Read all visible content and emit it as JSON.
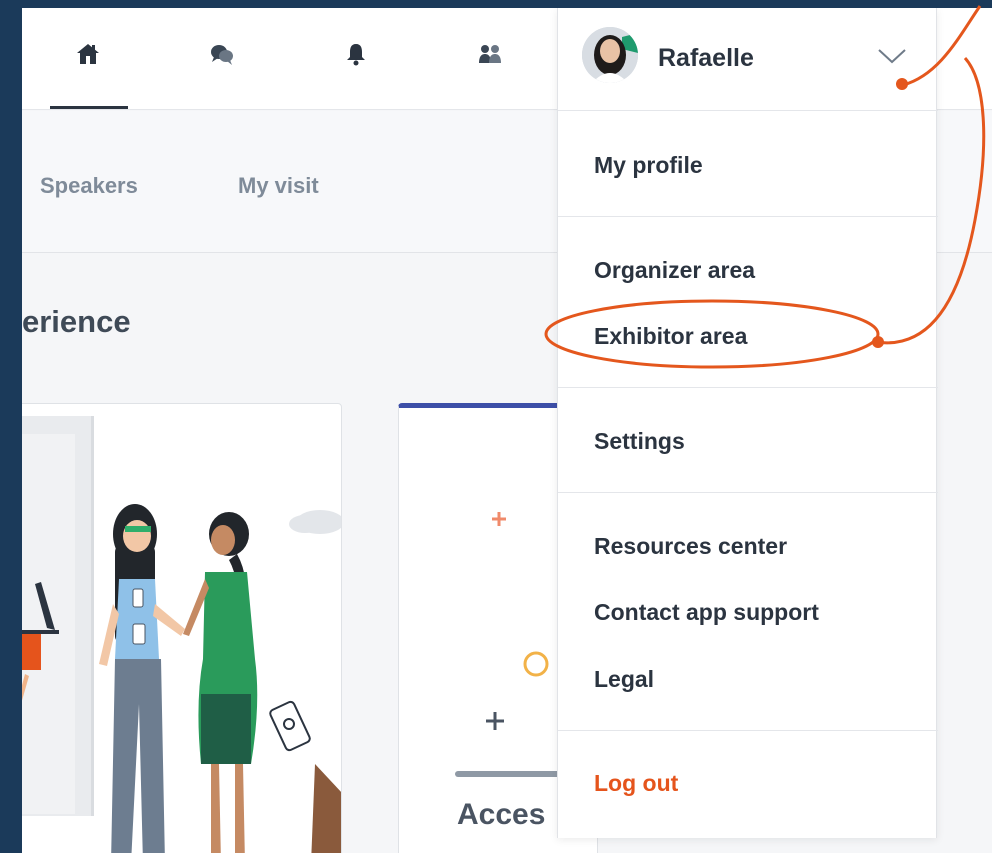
{
  "topnav": {
    "icons": [
      "home-icon",
      "chat-icon",
      "bell-icon",
      "people-icon"
    ]
  },
  "subnav": {
    "items": [
      {
        "label": "Speakers"
      },
      {
        "label": "My visit"
      }
    ]
  },
  "main": {
    "heading": "erience",
    "card_right_title": "Acces"
  },
  "user_menu": {
    "name": "Rafaelle",
    "items": [
      {
        "label": "My profile"
      },
      {
        "label": "Organizer area"
      },
      {
        "label": "Exhibitor area"
      },
      {
        "label": "Settings"
      },
      {
        "label": "Resources center"
      },
      {
        "label": "Contact app support"
      },
      {
        "label": "Legal"
      },
      {
        "label": "Log out"
      }
    ]
  },
  "colors": {
    "annotation": "#e4571d",
    "logout": "#e5541c",
    "frame": "#1b3a5a",
    "card_accent": "#3d4fa8"
  }
}
